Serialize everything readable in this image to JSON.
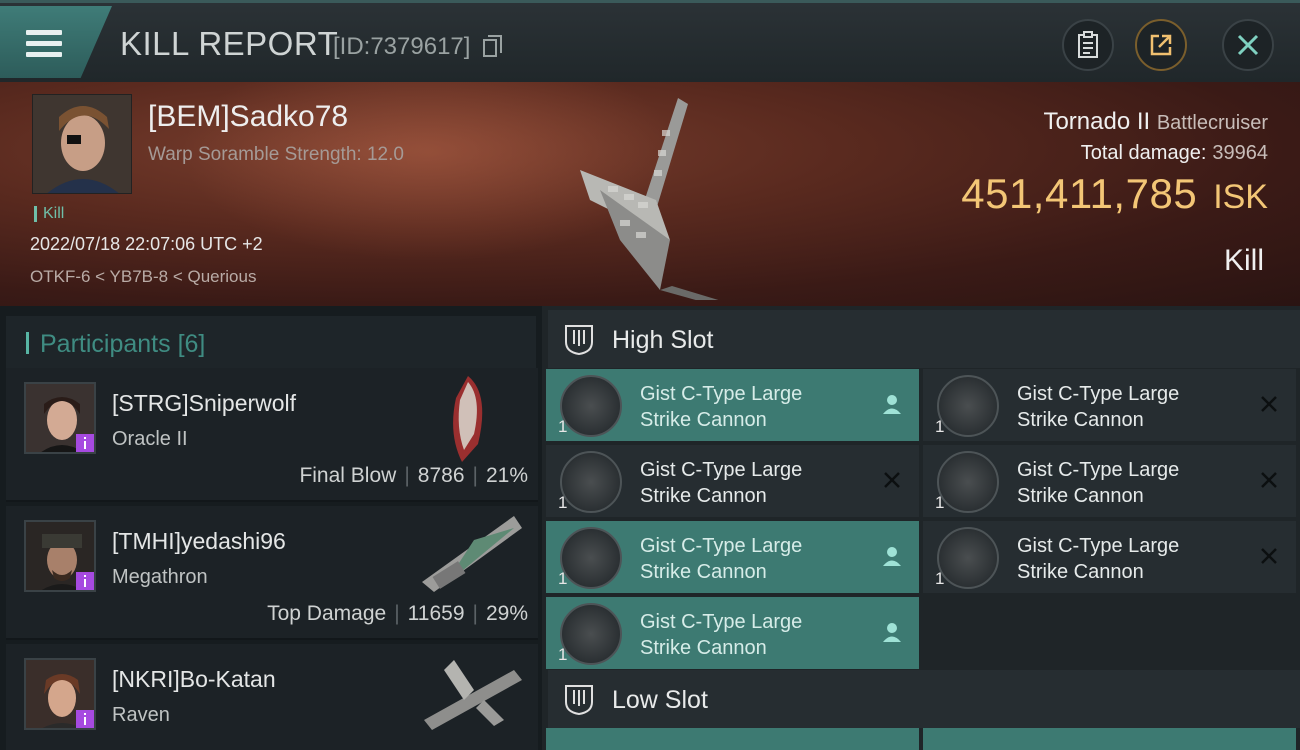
{
  "header": {
    "title": "KILL REPORT",
    "report_id": "[ID:7379617]"
  },
  "victim": {
    "name": "[BEM]Sadko78",
    "warp_scramble": "Warp Soramble Strength: 12.0",
    "tag": "Kill",
    "datetime": "2022/07/18 22:07:06 UTC +2",
    "location": "OTKF-6 < YB7B-8 < Querious",
    "ship_name": "Tornado II",
    "ship_class": "Battlecruiser",
    "total_damage_label": "Total damage:",
    "total_damage": "39964",
    "isk_value": "451,411,785",
    "isk_unit": "ISK",
    "type": "Kill"
  },
  "participants": {
    "label": "Participants",
    "count": "[6]",
    "items": [
      {
        "name": "[STRG]Sniperwolf",
        "ship": "Oracle II",
        "role": "Final Blow",
        "damage": "8786",
        "percent": "21%"
      },
      {
        "name": "[TMHI]yedashi96",
        "ship": "Megathron",
        "role": "Top Damage",
        "damage": "11659",
        "percent": "29%"
      },
      {
        "name": "[NKRI]Bo-Katan",
        "ship": "Raven",
        "role": "",
        "damage": "",
        "percent": ""
      }
    ]
  },
  "slots": {
    "high_label": "High Slot",
    "low_label": "Low Slot",
    "modules": [
      {
        "line1": "Gist C-Type Large",
        "line2": "Strike Cannon",
        "qty": "1",
        "state": "dropped"
      },
      {
        "line1": "Gist C-Type Large",
        "line2": "Strike Cannon",
        "qty": "1",
        "state": "destroyed"
      },
      {
        "line1": "Gist C-Type Large",
        "line2": "Strike Cannon",
        "qty": "1",
        "state": "destroyed"
      },
      {
        "line1": "Gist C-Type Large",
        "line2": "Strike Cannon",
        "qty": "1",
        "state": "destroyed"
      },
      {
        "line1": "Gist C-Type Large",
        "line2": "Strike Cannon",
        "qty": "1",
        "state": "dropped"
      },
      {
        "line1": "Gist C-Type Large",
        "line2": "Strike Cannon",
        "qty": "1",
        "state": "destroyed"
      },
      {
        "line1": "Gist C-Type Large",
        "line2": "Strike Cannon",
        "qty": "1",
        "state": "dropped"
      }
    ]
  },
  "icons": {
    "menu": "menu-icon",
    "copy": "copy-icon",
    "clipboard": "clipboard-icon",
    "share": "share-icon",
    "close": "close-icon"
  },
  "colors": {
    "accent_teal": "#3d7a72",
    "isk_gold": "#f3c676",
    "role_purple": "#a64ae0"
  }
}
